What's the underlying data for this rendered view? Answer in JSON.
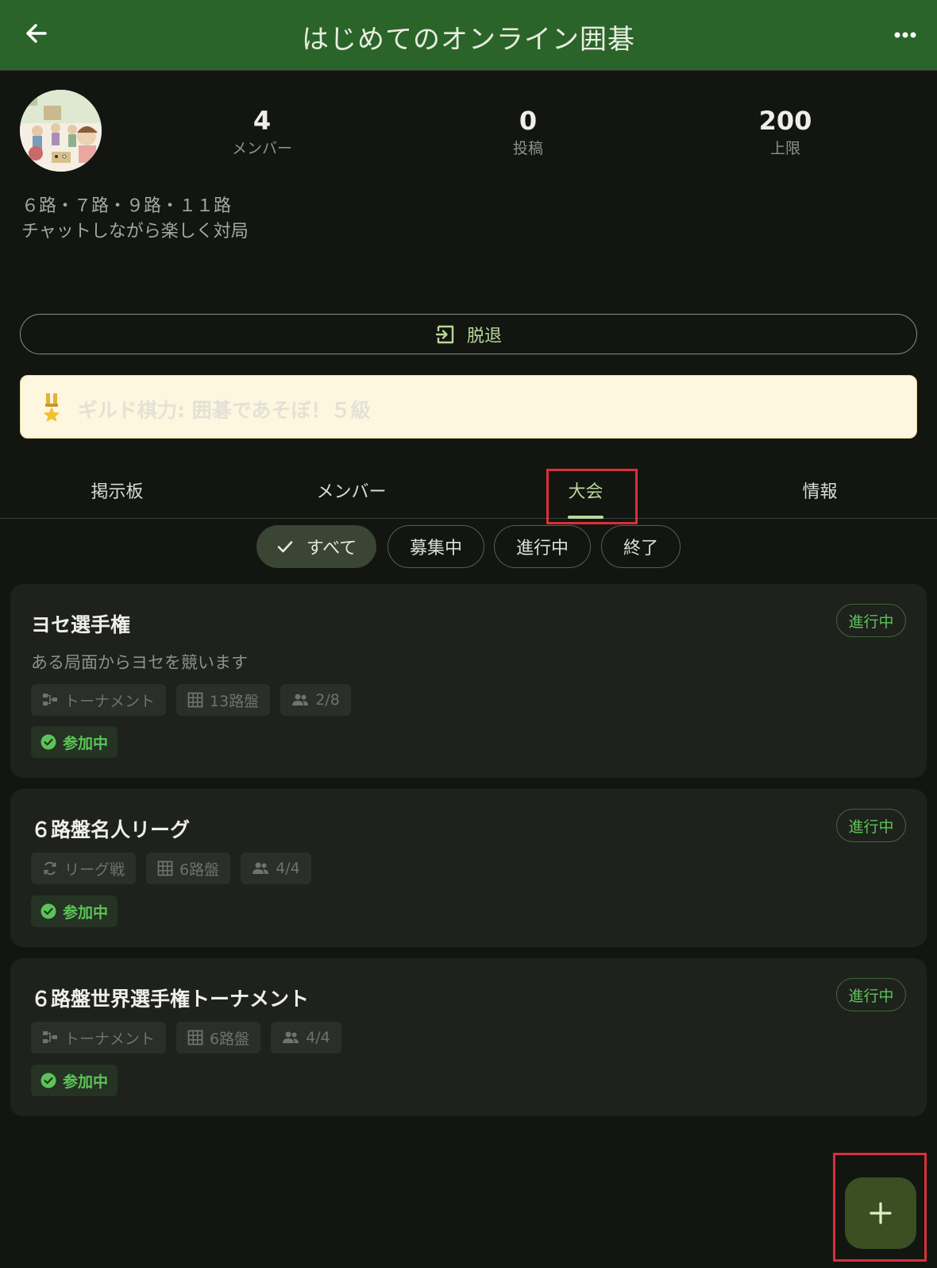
{
  "app_bar": {
    "title": "はじめてのオンライン囲碁",
    "back_icon": "arrow-left-icon",
    "more_icon": "more-horizontal-icon"
  },
  "profile": {
    "stats": [
      {
        "value": "4",
        "label": "メンバー"
      },
      {
        "value": "0",
        "label": "投稿"
      },
      {
        "value": "200",
        "label": "上限"
      }
    ],
    "description_line1": "６路・７路・９路・１１路",
    "description_line2": "チャットしながら楽しく対局"
  },
  "leave_button": {
    "label": "脱退",
    "icon": "logout-icon"
  },
  "guild_banner": {
    "label": "ギルド棋力: 囲碁であそぼ！５級",
    "icon": "medal-icon"
  },
  "tabs": [
    {
      "label": "掲示板"
    },
    {
      "label": "メンバー"
    },
    {
      "label": "大会"
    },
    {
      "label": "情報"
    }
  ],
  "active_tab": "大会",
  "filters": [
    {
      "label": "すべて",
      "selected": true
    },
    {
      "label": "募集中",
      "selected": false
    },
    {
      "label": "進行中",
      "selected": false
    },
    {
      "label": "終了",
      "selected": false
    }
  ],
  "tournaments": [
    {
      "title": "ヨセ選手権",
      "description": "ある局面からヨセを競います",
      "status": "進行中",
      "format": "トーナメント",
      "format_icon": "bracket-icon",
      "board": "13路盤",
      "players": "2/8",
      "joined": "参加中"
    },
    {
      "title": "６路盤名人リーグ",
      "description": "",
      "status": "進行中",
      "format": "リーグ戦",
      "format_icon": "sync-icon",
      "board": "6路盤",
      "players": "4/4",
      "joined": "参加中"
    },
    {
      "title": "６路盤世界選手権トーナメント",
      "description": "",
      "status": "進行中",
      "format": "トーナメント",
      "format_icon": "bracket-icon",
      "board": "6路盤",
      "players": "4/4",
      "joined": "参加中"
    }
  ],
  "fab": {
    "icon": "plus-icon"
  },
  "colors": {
    "app_bar": "#2a6428",
    "background": "#121510",
    "accent": "#b9d79a",
    "status_green": "#5bc456",
    "highlight_box": "#d8303a"
  }
}
